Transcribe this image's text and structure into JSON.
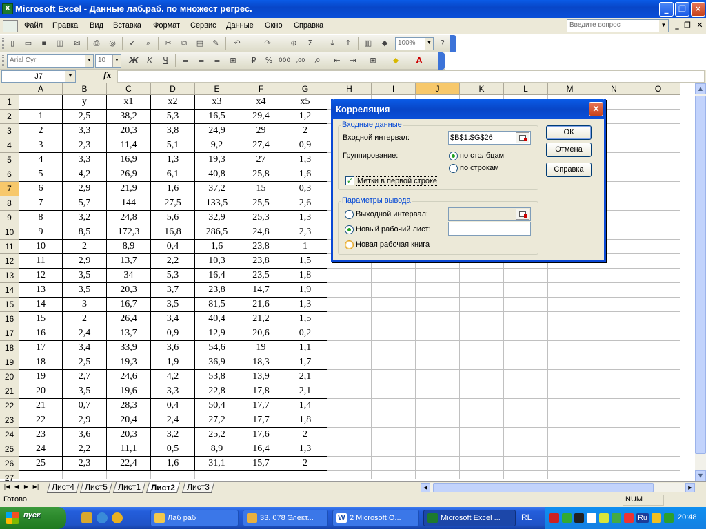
{
  "window": {
    "title": "Microsoft Excel - Данные лаб.раб. по множест регрес.",
    "minimize": "_",
    "restore": "❐",
    "close": "✕"
  },
  "menu": {
    "items": [
      "Файл",
      "Правка",
      "Вид",
      "Вставка",
      "Формат",
      "Сервис",
      "Данные",
      "Окно",
      "Справка"
    ],
    "help_placeholder": "Введите вопрос"
  },
  "toolbar": {
    "zoom": "100%",
    "font": "Arial Cyr",
    "size": "10",
    "bold": "Ж",
    "italic": "К",
    "underline": "Ч"
  },
  "formula_bar": {
    "name_box": "J7",
    "fx": "fx",
    "formula": ""
  },
  "columns": [
    "A",
    "B",
    "C",
    "D",
    "E",
    "F",
    "G",
    "H",
    "I",
    "J",
    "K",
    "L",
    "M",
    "N",
    "O"
  ],
  "selected_cell": {
    "col": "J",
    "row": 7
  },
  "table": {
    "header": [
      "",
      "y",
      "x1",
      "x2",
      "x3",
      "x4",
      "x5"
    ],
    "rows": [
      [
        "1",
        "2,5",
        "38,2",
        "5,3",
        "16,5",
        "29,4",
        "1,2"
      ],
      [
        "2",
        "3,3",
        "20,3",
        "3,8",
        "24,9",
        "29",
        "2"
      ],
      [
        "3",
        "2,3",
        "11,4",
        "5,1",
        "9,2",
        "27,4",
        "0,9"
      ],
      [
        "4",
        "3,3",
        "16,9",
        "1,3",
        "19,3",
        "27",
        "1,3"
      ],
      [
        "5",
        "4,2",
        "26,9",
        "6,1",
        "40,8",
        "25,8",
        "1,6"
      ],
      [
        "6",
        "2,9",
        "21,9",
        "1,6",
        "37,2",
        "15",
        "0,3"
      ],
      [
        "7",
        "5,7",
        "144",
        "27,5",
        "133,5",
        "25,5",
        "2,6"
      ],
      [
        "8",
        "3,2",
        "24,8",
        "5,6",
        "32,9",
        "25,3",
        "1,3"
      ],
      [
        "9",
        "8,5",
        "172,3",
        "16,8",
        "286,5",
        "24,8",
        "2,3"
      ],
      [
        "10",
        "2",
        "8,9",
        "0,4",
        "1,6",
        "23,8",
        "1"
      ],
      [
        "11",
        "2,9",
        "13,7",
        "2,2",
        "10,3",
        "23,8",
        "1,5"
      ],
      [
        "12",
        "3,5",
        "34",
        "5,3",
        "16,4",
        "23,5",
        "1,8"
      ],
      [
        "13",
        "3,5",
        "20,3",
        "3,7",
        "23,8",
        "14,7",
        "1,9"
      ],
      [
        "14",
        "3",
        "16,7",
        "3,5",
        "81,5",
        "21,6",
        "1,3"
      ],
      [
        "15",
        "2",
        "26,4",
        "3,4",
        "40,4",
        "21,2",
        "1,5"
      ],
      [
        "16",
        "2,4",
        "13,7",
        "0,9",
        "12,9",
        "20,6",
        "0,2"
      ],
      [
        "17",
        "3,4",
        "33,9",
        "3,6",
        "54,6",
        "19",
        "1,1"
      ],
      [
        "18",
        "2,5",
        "19,3",
        "1,9",
        "36,9",
        "18,3",
        "1,7"
      ],
      [
        "19",
        "2,7",
        "24,6",
        "4,2",
        "53,8",
        "13,9",
        "2,1"
      ],
      [
        "20",
        "3,5",
        "19,6",
        "3,3",
        "22,8",
        "17,8",
        "2,1"
      ],
      [
        "21",
        "0,7",
        "28,3",
        "0,4",
        "50,4",
        "17,7",
        "1,4"
      ],
      [
        "22",
        "2,9",
        "20,4",
        "2,4",
        "27,2",
        "17,7",
        "1,8"
      ],
      [
        "23",
        "3,6",
        "20,3",
        "3,2",
        "25,2",
        "17,6",
        "2"
      ],
      [
        "24",
        "2,2",
        "11,1",
        "0,5",
        "8,9",
        "16,4",
        "1,3"
      ],
      [
        "25",
        "2,3",
        "22,4",
        "1,6",
        "31,1",
        "15,7",
        "2"
      ]
    ]
  },
  "sheets": {
    "tabs": [
      "Лист4",
      "Лист5",
      "Лист1",
      "Лист2",
      "Лист3"
    ],
    "active": "Лист2"
  },
  "status": {
    "left": "Готово",
    "num": "NUM"
  },
  "dialog": {
    "title": "Корреляция",
    "input_group": "Входные данные",
    "input_range_label": "Входной интервал:",
    "input_range_value": "$B$1:$G$26",
    "grouping_label": "Группирование:",
    "by_columns": "по столбцам",
    "by_rows": "по строкам",
    "labels_first_row": "Метки в первой строке",
    "output_group": "Параметры вывода",
    "output_range": "Выходной интервал:",
    "new_sheet": "Новый рабочий лист:",
    "new_workbook": "Новая рабочая книга",
    "ok": "ОК",
    "cancel": "Отмена",
    "help": "Справка"
  },
  "taskbar": {
    "start": "пуск",
    "tasks": [
      "Лаб раб",
      "33. 078 Элект...",
      "2 Microsoft O...",
      "Microsoft Excel ..."
    ],
    "lang": "RL",
    "tray_lang": "Ru",
    "clock": "20:48"
  }
}
